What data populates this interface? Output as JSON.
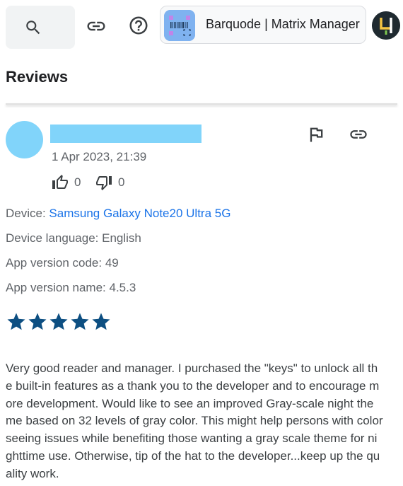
{
  "header": {
    "app_name": "Barquode | Matrix Manager"
  },
  "section_title": "Reviews",
  "review": {
    "date": "1 Apr 2023, 21:39",
    "thumbs_up_count": "0",
    "thumbs_down_count": "0",
    "device_label": "Device:",
    "device_value": "Samsung Galaxy Note20 Ultra 5G",
    "device_language_label": "Device language:",
    "device_language_value": "English",
    "app_version_code_label": "App version code:",
    "app_version_code_value": "49",
    "app_version_name_label": "App version name:",
    "app_version_name_value": "4.5.3",
    "rating": 5,
    "text": "Very good reader and manager. I purchased the \"keys\" to unlock all the built-in features as a thank you to the developer and to encourage more development. Would like to see an improved Gray-scale night theme based on 32 levels of gray color. This might help persons with color seeing issues while benefiting those wanting a gray scale theme for nighttime use. Otherwise, tip of the hat to the developer...keep up the quality work."
  },
  "colors": {
    "star": "#0d4f82",
    "link": "#1a73e8",
    "avatar_placeholder": "#81d4fa"
  },
  "icons": [
    "search-icon",
    "link-icon",
    "help-icon",
    "flag-icon",
    "thumb-up-icon",
    "thumb-down-icon",
    "star-icon"
  ]
}
